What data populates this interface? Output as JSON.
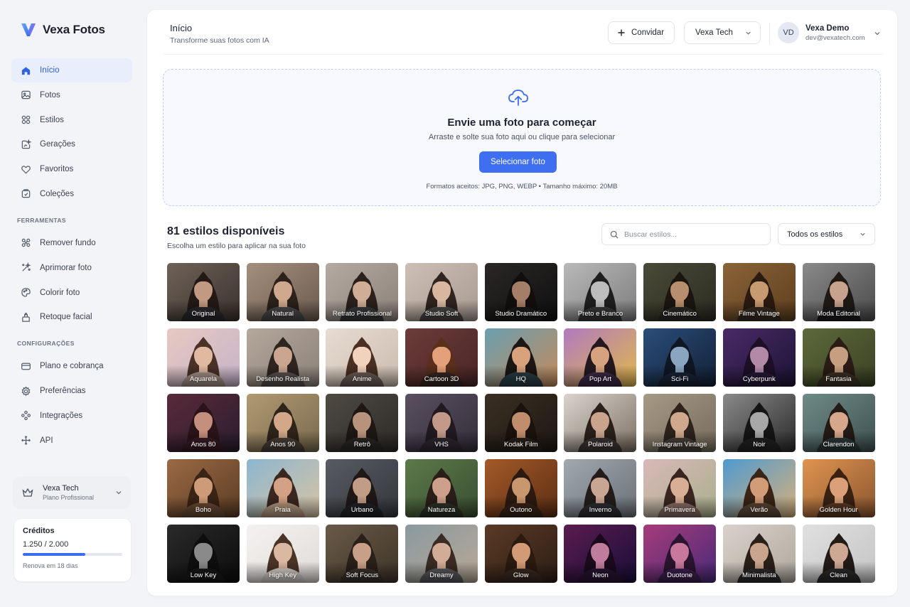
{
  "app": {
    "name": "Vexa Fotos"
  },
  "sidebar": {
    "nav": [
      {
        "label": "Início",
        "icon": "home-icon",
        "active": true
      },
      {
        "label": "Fotos",
        "icon": "image-icon"
      },
      {
        "label": "Estilos",
        "icon": "grid-icon"
      },
      {
        "label": "Gerações",
        "icon": "sparkle-image-icon"
      },
      {
        "label": "Favoritos",
        "icon": "heart-icon"
      },
      {
        "label": "Coleções",
        "icon": "collection-icon"
      }
    ],
    "tools_title": "FERRAMENTAS",
    "tools": [
      {
        "label": "Remover fundo",
        "icon": "magic-wand-icon"
      },
      {
        "label": "Aprimorar foto",
        "icon": "enhance-icon"
      },
      {
        "label": "Colorir foto",
        "icon": "palette-icon"
      },
      {
        "label": "Retoque facial",
        "icon": "face-retouch-icon"
      }
    ],
    "config_title": "CONFIGURAÇÕES",
    "config": [
      {
        "label": "Plano e cobrança",
        "icon": "card-icon"
      },
      {
        "label": "Preferências",
        "icon": "gear-icon"
      },
      {
        "label": "Integrações",
        "icon": "integrations-icon"
      },
      {
        "label": "API",
        "icon": "api-icon"
      }
    ],
    "workspace": {
      "name": "Vexa Tech",
      "plan": "Plano Profissional"
    },
    "credits": {
      "title": "Créditos",
      "value": "1.250 / 2.000",
      "progress": 0.625,
      "renew": "Renova em 18 dias"
    }
  },
  "header": {
    "title": "Início",
    "subtitle": "Transforme suas fotos com IA",
    "invite_label": "Convidar",
    "team_label": "Vexa Tech",
    "user": {
      "initials": "VD",
      "name": "Vexa Demo",
      "email": "dev@vexatech.com"
    }
  },
  "upload": {
    "title": "Envie uma foto para começar",
    "subtitle": "Arraste e solte sua foto aqui ou clique para selecionar",
    "button": "Selecionar foto",
    "formats": "Formatos aceitos: JPG, PNG, WEBP • Tamanho máximo: 20MB"
  },
  "styles": {
    "title": "81 estilos disponíveis",
    "subtitle": "Escolha um estilo para aplicar na sua foto",
    "search_placeholder": "Buscar estilos...",
    "filter_label": "Todos os estilos",
    "items": [
      {
        "label": "Original",
        "bg": "#6f6258",
        "bg2": "#3a322d",
        "skin": "#c29a82",
        "hair": "#231a16",
        "shirt": "#2c2a2d"
      },
      {
        "label": "Natural",
        "bg": "#a48f7d",
        "bg2": "#6b5b4f",
        "skin": "#cfa88e",
        "hair": "#2d211b",
        "shirt": "#4d4a4a"
      },
      {
        "label": "Retrato Profissional",
        "bg": "#b5aaa2",
        "bg2": "#8c8179",
        "skin": "#d0ad96",
        "hair": "#2b211c",
        "shirt": "#3b3a3d"
      },
      {
        "label": "Studio Soft",
        "bg": "#cdbfb4",
        "bg2": "#a79a90",
        "skin": "#d8b7a0",
        "hair": "#30241e",
        "shirt": "#4b4747"
      },
      {
        "label": "Studio Dramático",
        "bg": "#2a2726",
        "bg2": "#101010",
        "skin": "#a57e68",
        "hair": "#120e0c",
        "shirt": "#1b1a1b"
      },
      {
        "label": "Preto e Branco",
        "bg": "#b9b9b9",
        "bg2": "#7d7d7d",
        "skin": "#bdbdbd",
        "hair": "#1e1e1e",
        "shirt": "#3a3a3a"
      },
      {
        "label": "Cinemático",
        "bg": "#4a4a38",
        "bg2": "#2c2c22",
        "skin": "#b88f6e",
        "hair": "#1a1510",
        "shirt": "#2b2a25"
      },
      {
        "label": "Filme Vintage",
        "bg": "#8a6338",
        "bg2": "#5e3f1f",
        "skin": "#c89a72",
        "hair": "#2a1a10",
        "shirt": "#3a2d22"
      },
      {
        "label": "Moda Editorial",
        "bg": "#8a8a8a",
        "bg2": "#4a4a4a",
        "skin": "#c7a28d",
        "hair": "#1f1915",
        "shirt": "#1d1d1f"
      },
      {
        "label": "Aquarela",
        "bg": "#e7c9c1",
        "bg2": "#c5b3c9",
        "skin": "#e0b9a0",
        "hair": "#4a3228",
        "shirt": "#a99488"
      },
      {
        "label": "Desenho Realista",
        "bg": "#b4a89c",
        "bg2": "#8c8178",
        "skin": "#caa690",
        "hair": "#2f2520",
        "shirt": "#5a5450"
      },
      {
        "label": "Anime",
        "bg": "#e7dcd2",
        "bg2": "#cbbbae",
        "skin": "#f0d2bd",
        "hair": "#4a2f22",
        "shirt": "#6f5e58"
      },
      {
        "label": "Cartoon 3D",
        "bg": "#6b3c3a",
        "bg2": "#4a2625",
        "skin": "#e4a07a",
        "hair": "#5a2f1c",
        "shirt": "#3a2623"
      },
      {
        "label": "HQ",
        "bg": "#6a9fb0",
        "bg2": "#c58a5a",
        "skin": "#d9a27c",
        "hair": "#1c1614",
        "shirt": "#2b3e46"
      },
      {
        "label": "Pop Art",
        "bg": "#b07ac0",
        "bg2": "#e1b84a",
        "skin": "#d7a37e",
        "hair": "#24181e",
        "shirt": "#3d2b48"
      },
      {
        "label": "Sci-Fi",
        "bg": "#2a4e7a",
        "bg2": "#132036",
        "skin": "#8ba5c0",
        "hair": "#0f1724",
        "shirt": "#1a2438"
      },
      {
        "label": "Cyberpunk",
        "bg": "#4a2a66",
        "bg2": "#1c1436",
        "skin": "#b28aa8",
        "hair": "#1c0f26",
        "shirt": "#271a3a"
      },
      {
        "label": "Fantasia",
        "bg": "#5d6a3a",
        "bg2": "#3b4124",
        "skin": "#c69e80",
        "hair": "#2a1c14",
        "shirt": "#3c3224"
      },
      {
        "label": "Anos 80",
        "bg": "#5a2a3a",
        "bg2": "#2a1e2e",
        "skin": "#c48f7d",
        "hair": "#2a141a",
        "shirt": "#3a1c26"
      },
      {
        "label": "Anos 90",
        "bg": "#b09a72",
        "bg2": "#7a6a4e",
        "skin": "#d2a888",
        "hair": "#2f241a",
        "shirt": "#4c4038"
      },
      {
        "label": "Retrô",
        "bg": "#4f4a44",
        "bg2": "#2d2a27",
        "skin": "#b8937c",
        "hair": "#1e1714",
        "shirt": "#2c2927"
      },
      {
        "label": "VHS",
        "bg": "#5a5060",
        "bg2": "#342e3a",
        "skin": "#c39a8a",
        "hair": "#221a20",
        "shirt": "#302a33"
      },
      {
        "label": "Kodak Film",
        "bg": "#3a2f24",
        "bg2": "#1e1812",
        "skin": "#c08e6c",
        "hair": "#1a120c",
        "shirt": "#2a221b"
      },
      {
        "label": "Polaroid",
        "bg": "#d9d4cd",
        "bg2": "#7e7064",
        "skin": "#c9a38c",
        "hair": "#2a201b",
        "shirt": "#3e3835"
      },
      {
        "label": "Instagram Vintage",
        "bg": "#a69a86",
        "bg2": "#766b5c",
        "skin": "#d0a98c",
        "hair": "#2d231c",
        "shirt": "#4a423a"
      },
      {
        "label": "Noir",
        "bg": "#8a8a8a",
        "bg2": "#2a2a2a",
        "skin": "#a8a8a8",
        "hair": "#151515",
        "shirt": "#222222"
      },
      {
        "label": "Clarendon",
        "bg": "#6f8a88",
        "bg2": "#3e5250",
        "skin": "#d6a78a",
        "hair": "#241a15",
        "shirt": "#2e3a3a"
      },
      {
        "label": "Boho",
        "bg": "#9a6a44",
        "bg2": "#5c3c24",
        "skin": "#cd9b78",
        "hair": "#3a2416",
        "shirt": "#6a4a34"
      },
      {
        "label": "Praia",
        "bg": "#8db6cf",
        "bg2": "#d8c3a4",
        "skin": "#d3a184",
        "hair": "#3a2820",
        "shirt": "#b89a80"
      },
      {
        "label": "Urbano",
        "bg": "#585c62",
        "bg2": "#34373c",
        "skin": "#c19c86",
        "hair": "#1e1816",
        "shirt": "#232427"
      },
      {
        "label": "Natureza",
        "bg": "#5c7a4a",
        "bg2": "#3a4e30",
        "skin": "#cca08a",
        "hair": "#2a1e18",
        "shirt": "#2e3328"
      },
      {
        "label": "Outono",
        "bg": "#a35a28",
        "bg2": "#5c2e14",
        "skin": "#c9976f",
        "hair": "#2c1a10",
        "shirt": "#3a2418"
      },
      {
        "label": "Inverno",
        "bg": "#a2a8b0",
        "bg2": "#6a7078",
        "skin": "#c9a694",
        "hair": "#231c1a",
        "shirt": "#2f2f34"
      },
      {
        "label": "Primavera",
        "bg": "#d9b8b8",
        "bg2": "#a9b08c",
        "skin": "#d8ae95",
        "hair": "#3a2620",
        "shirt": "#8a6f64"
      },
      {
        "label": "Verão",
        "bg": "#4f9ad0",
        "bg2": "#d7b07a",
        "skin": "#d29c78",
        "hair": "#3a2416",
        "shirt": "#5a4636"
      },
      {
        "label": "Golden Hour",
        "bg": "#e09450",
        "bg2": "#8a5630",
        "skin": "#dba07a",
        "hair": "#3a2212",
        "shirt": "#5a3a26"
      },
      {
        "label": "Low Key",
        "bg": "#2a2a2a",
        "bg2": "#0c0c0c",
        "skin": "#8a8a8a",
        "hair": "#0e0e0e",
        "shirt": "#181818"
      },
      {
        "label": "High Key",
        "bg": "#f4f2f0",
        "bg2": "#e0dcd8",
        "skin": "#dbb8a2",
        "hair": "#4a3426",
        "shirt": "#d8d0ca"
      },
      {
        "label": "Soft Focus",
        "bg": "#6a5a48",
        "bg2": "#3e3428",
        "skin": "#c8a088",
        "hair": "#2a201a",
        "shirt": "#3a322c"
      },
      {
        "label": "Dreamy",
        "bg": "#8a9aa0",
        "bg2": "#b8a896",
        "skin": "#d2ac96",
        "hair": "#3a2c24",
        "shirt": "#5a5a5e"
      },
      {
        "label": "Glow",
        "bg": "#5a3a26",
        "bg2": "#2e1e14",
        "skin": "#d39a76",
        "hair": "#2a1a10",
        "shirt": "#3a2a20"
      },
      {
        "label": "Neon",
        "bg": "#5a1c4e",
        "bg2": "#1a0e3a",
        "skin": "#c07c9c",
        "hair": "#1a0a1c",
        "shirt": "#2a1434"
      },
      {
        "label": "Duotone",
        "bg": "#a63c7a",
        "bg2": "#4a2a7a",
        "skin": "#c8789c",
        "hair": "#2a1430",
        "shirt": "#3e2050"
      },
      {
        "label": "Minimalista",
        "bg": "#d8d2ca",
        "bg2": "#b0a89e",
        "skin": "#caa48c",
        "hair": "#2a201a",
        "shirt": "#2e2c2c"
      },
      {
        "label": "Clean",
        "bg": "#e0e0e0",
        "bg2": "#c4c4c4",
        "skin": "#cfa894",
        "hair": "#231b17",
        "shirt": "#2c2c2e"
      }
    ]
  },
  "colors": {
    "accent": "#3e6ff0",
    "active_bg": "#e8eefc",
    "page_bg": "#f3f4f7"
  }
}
